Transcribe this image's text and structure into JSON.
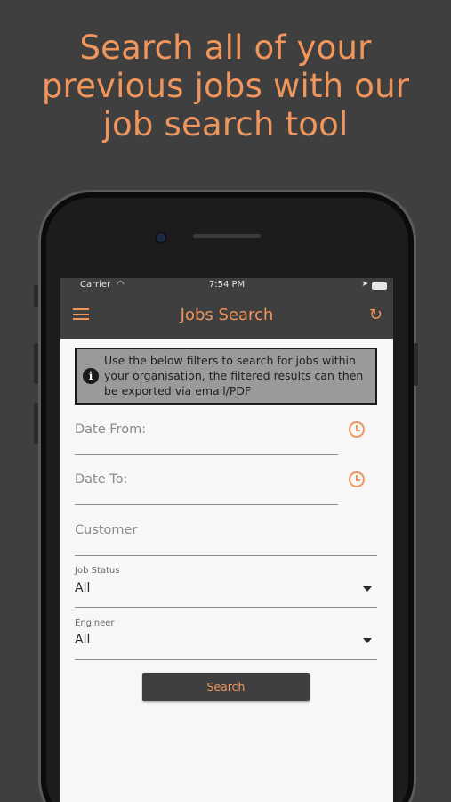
{
  "headline": {
    "line1": "Search all of your",
    "line2": "previous jobs with our",
    "line3": "job search tool"
  },
  "status_bar": {
    "carrier": "Carrier",
    "time": "7:54 PM"
  },
  "nav": {
    "title": "Jobs Search",
    "menu_icon": "hamburger-menu-icon",
    "refresh_icon": "refresh-icon"
  },
  "info_box": {
    "text": "Use the below filters to search for jobs within your organisation, the filtered results can then be exported via email/PDF"
  },
  "form": {
    "date_from_placeholder": "Date From:",
    "date_to_placeholder": "Date To:",
    "customer_placeholder": "Customer",
    "job_status_label": "Job Status",
    "job_status_value": "All",
    "engineer_label": "Engineer",
    "engineer_value": "All",
    "search_button": "Search"
  },
  "colors": {
    "accent": "#f0955c",
    "dark": "#3f3f3f",
    "screen_bg": "#f7f7f7"
  }
}
